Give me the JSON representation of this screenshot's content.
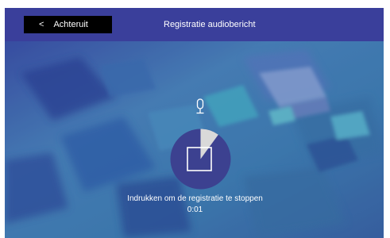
{
  "header": {
    "back_chevron": "<",
    "back_label": "Achteruit",
    "title": "Registratie audiobericht"
  },
  "recording": {
    "instruction": "Indrukken om de registratie te stoppen",
    "elapsed": "0:01",
    "progress_fraction": 0.1,
    "icons": [
      "microphone-icon",
      "stop-icon"
    ]
  },
  "colors": {
    "header_bg": "#3a3f9b",
    "back_button_bg": "#000000",
    "record_circle": "#3c4190",
    "progress_wedge": "#d9d9d9",
    "text": "#ffffff"
  }
}
